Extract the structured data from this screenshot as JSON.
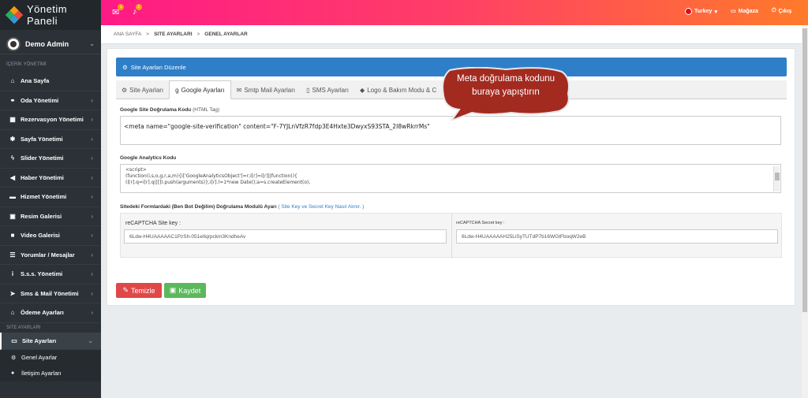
{
  "brand": {
    "title": "Yönetim Paneli"
  },
  "user": {
    "name": "Demo Admin"
  },
  "sidebar": {
    "section1": "İÇERİK YÖNETİMİ",
    "items": [
      {
        "label": "Ana Sayfa",
        "icon": "home-icon",
        "glyph": "⌂"
      },
      {
        "label": "Oda Yönetimi",
        "icon": "bed-icon",
        "glyph": "⚭"
      },
      {
        "label": "Rezervasyon Yönetimi",
        "icon": "table-icon",
        "glyph": "▦"
      },
      {
        "label": "Sayfa Yönetimi",
        "icon": "asterisk-icon",
        "glyph": "✱"
      },
      {
        "label": "Slider Yönetimi",
        "icon": "bolt-icon",
        "glyph": "ϟ"
      },
      {
        "label": "Haber Yönetimi",
        "icon": "bullhorn-icon",
        "glyph": "◀"
      },
      {
        "label": "Hizmet Yönetimi",
        "icon": "suitcase-icon",
        "glyph": "▬"
      },
      {
        "label": "Resim Galerisi",
        "icon": "image-icon",
        "glyph": "▣"
      },
      {
        "label": "Video Galerisi",
        "icon": "video-icon",
        "glyph": "■"
      },
      {
        "label": "Yorumlar / Mesajlar",
        "icon": "list-icon",
        "glyph": "☰"
      },
      {
        "label": "S.s.s. Yönetimi",
        "icon": "info-icon",
        "glyph": "i"
      },
      {
        "label": "Sms & Mail Yönetimi",
        "icon": "paper-plane-icon",
        "glyph": "➤"
      },
      {
        "label": "Ödeme Ayarları",
        "icon": "bank-icon",
        "glyph": "⌂"
      }
    ],
    "section2": "Site Ayarları",
    "active_item": {
      "label": "Site Ayarları",
      "icon": "monitor-icon",
      "glyph": "▭"
    },
    "sub_items": [
      {
        "label": "Genel Ayarlar",
        "icon": "cogs-icon",
        "glyph": "⚙"
      },
      {
        "label": "İletişim Ayarları",
        "icon": "map-marker-icon",
        "glyph": "●"
      }
    ]
  },
  "topbar": {
    "mail_badge": "1",
    "bell_badge": "3",
    "language": "Turkey",
    "store": "Mağaza",
    "logout": "Çıkış"
  },
  "breadcrumb": {
    "home": "ANA SAYFA",
    "sep": ">",
    "settings": "SITE AYARLARI",
    "current": "GENEL AYARLAR"
  },
  "panel": {
    "header": "Site Ayarları Düzenle",
    "tabs": [
      {
        "label": "Site Ayarları",
        "icon": "gear-icon",
        "glyph": "⚙"
      },
      {
        "label": "Google Ayarları",
        "icon": "google-icon",
        "glyph": "g",
        "active": true
      },
      {
        "label": "Smtp Mail Ayarları",
        "icon": "envelope-icon",
        "glyph": "✉"
      },
      {
        "label": "SMS Ayarları",
        "icon": "mobile-icon",
        "glyph": "▯"
      },
      {
        "label": "Logo & Bakım Modu & C",
        "icon": "tag-icon",
        "glyph": "◆"
      }
    ],
    "verification": {
      "label": "Google Site Doğrulama Kodu",
      "sub": "(HTML Tag)",
      "value": "<meta name=\"google-site-verification\" content=\"F-7YJLnVfzR7fdp3E4Hxte3DwyxS93STA_2I8wRkrrMs\""
    },
    "analytics": {
      "label": "Google Analytics Kodu",
      "lines": [
        "<script>",
        "  (function(i,s,o,g,r,a,m){i['GoogleAnalyticsObject']=r;i[r]=i[r]||function(){",
        "  (i[r].q=i[r].q||[]).push(arguments)},i[r].l=1*new Date();a=s.createElement(o),"
      ]
    },
    "recaptcha": {
      "label": "Sitedeki Formlardaki (Ben Bot Değilim) Doğrulama Modulü Ayarı",
      "link": "( Site Key ve Secret Key Nasıl Alınır. )",
      "site_key_label": "reCAPTCHA Site key :",
      "site_key": "6Ldw-H4UAAAAAC1PzSh-051eIlqrpckm3KndheAv",
      "secret_key_label": "reCAPTCHA Secret key :",
      "secret_key": "6Ldw-H4UAAAAAH25LiSyTUTdP7b16WGtFboqW2eB"
    },
    "buttons": {
      "clear": "Temizle",
      "save": "Kaydet"
    }
  },
  "callout": {
    "line1": "Meta doğrulama kodunu",
    "line2": "buraya yapıştırın"
  }
}
